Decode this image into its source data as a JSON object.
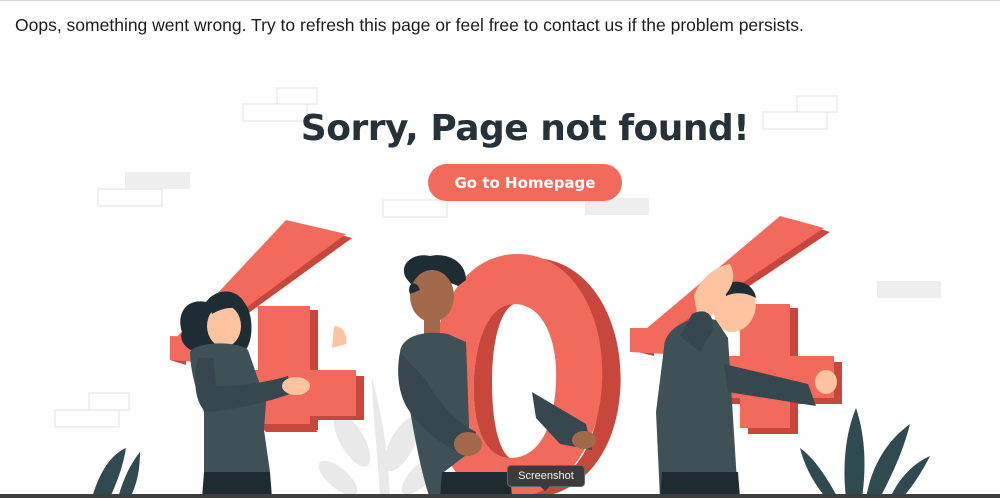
{
  "error_message": "Oops, something went wrong. Try to refresh this page or feel free to contact us if the problem persists.",
  "heading": "Sorry, Page not found!",
  "home_button_label": "Go to Homepage",
  "tooltip_label": "Screenshot",
  "colors": {
    "accent": "#f26a5b",
    "accent_dark": "#c8473c",
    "heading": "#263238",
    "shirt": "#37474f",
    "skin_light": "#ffc3a0",
    "skin_dark": "#a26a4b"
  }
}
